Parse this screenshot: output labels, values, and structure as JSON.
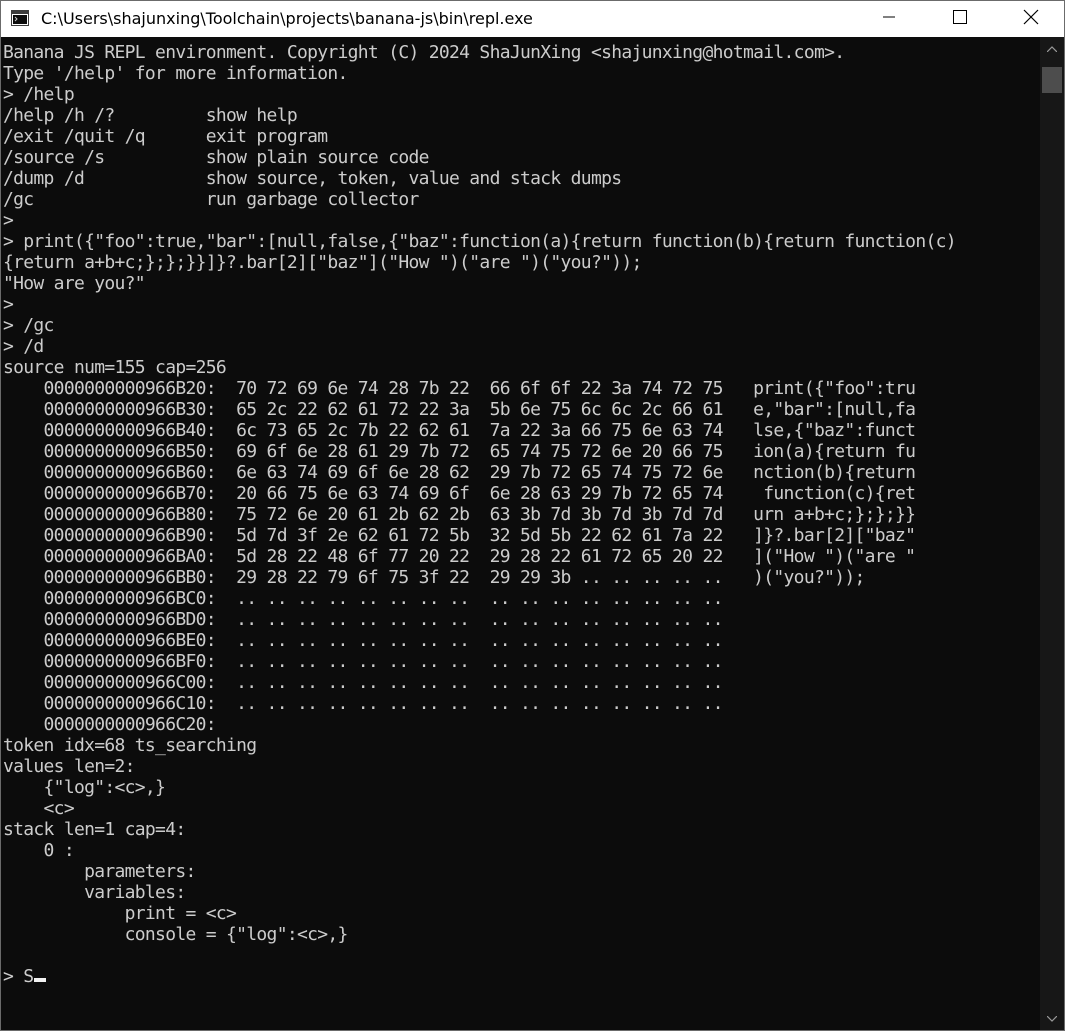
{
  "window": {
    "title": "C:\\Users\\shajunxing\\Toolchain\\projects\\banana-js\\bin\\repl.exe",
    "controls": {
      "minimize_icon": "minimize-icon",
      "maximize_icon": "maximize-icon",
      "close_icon": "close-icon"
    }
  },
  "console": {
    "lines": [
      "Banana JS REPL environment. Copyright (C) 2024 ShaJunXing <shajunxing@hotmail.com>.",
      "Type '/help' for more information.",
      "> /help",
      "/help /h /?         show help",
      "/exit /quit /q      exit program",
      "/source /s          show plain source code",
      "/dump /d            show source, token, value and stack dumps",
      "/gc                 run garbage collector",
      ">",
      "> print({\"foo\":true,\"bar\":[null,false,{\"baz\":function(a){return function(b){return function(c)",
      "{return a+b+c;};};}}]}?.bar[2][\"baz\"](\"How \")(\"are \")(\"you?\"));",
      "\"How are you?\"",
      ">",
      "> /gc",
      "> /d",
      "source num=155 cap=256",
      "    0000000000966B20:  70 72 69 6e 74 28 7b 22  66 6f 6f 22 3a 74 72 75   print({\"foo\":tru",
      "    0000000000966B30:  65 2c 22 62 61 72 22 3a  5b 6e 75 6c 6c 2c 66 61   e,\"bar\":[null,fa",
      "    0000000000966B40:  6c 73 65 2c 7b 22 62 61  7a 22 3a 66 75 6e 63 74   lse,{\"baz\":funct",
      "    0000000000966B50:  69 6f 6e 28 61 29 7b 72  65 74 75 72 6e 20 66 75   ion(a){return fu",
      "    0000000000966B60:  6e 63 74 69 6f 6e 28 62  29 7b 72 65 74 75 72 6e   nction(b){return",
      "    0000000000966B70:  20 66 75 6e 63 74 69 6f  6e 28 63 29 7b 72 65 74    function(c){ret",
      "    0000000000966B80:  75 72 6e 20 61 2b 62 2b  63 3b 7d 3b 7d 3b 7d 7d   urn a+b+c;};};}}",
      "    0000000000966B90:  5d 7d 3f 2e 62 61 72 5b  32 5d 5b 22 62 61 7a 22   ]}?.bar[2][\"baz\"",
      "    0000000000966BA0:  5d 28 22 48 6f 77 20 22  29 28 22 61 72 65 20 22   ](\"How \")(\"are \"",
      "    0000000000966BB0:  29 28 22 79 6f 75 3f 22  29 29 3b .. .. .. .. ..   )(\"you?\"));",
      "    0000000000966BC0:  .. .. .. .. .. .. .. ..  .. .. .. .. .. .. .. ..",
      "    0000000000966BD0:  .. .. .. .. .. .. .. ..  .. .. .. .. .. .. .. ..",
      "    0000000000966BE0:  .. .. .. .. .. .. .. ..  .. .. .. .. .. .. .. ..",
      "    0000000000966BF0:  .. .. .. .. .. .. .. ..  .. .. .. .. .. .. .. ..",
      "    0000000000966C00:  .. .. .. .. .. .. .. ..  .. .. .. .. .. .. .. ..",
      "    0000000000966C10:  .. .. .. .. .. .. .. ..  .. .. .. .. .. .. .. ..",
      "    0000000000966C20:",
      "token idx=68 ts_searching",
      "values len=2:",
      "    {\"log\":<c>,}",
      "    <c>",
      "stack len=1 cap=4:",
      "    0 :",
      "        parameters:",
      "        variables:",
      "            print = <c>",
      "            console = {\"log\":<c>,}",
      "",
      "> S"
    ]
  },
  "scrollbar": {
    "up_icon": "scroll-up-arrow-icon",
    "down_icon": "scroll-down-arrow-icon"
  }
}
